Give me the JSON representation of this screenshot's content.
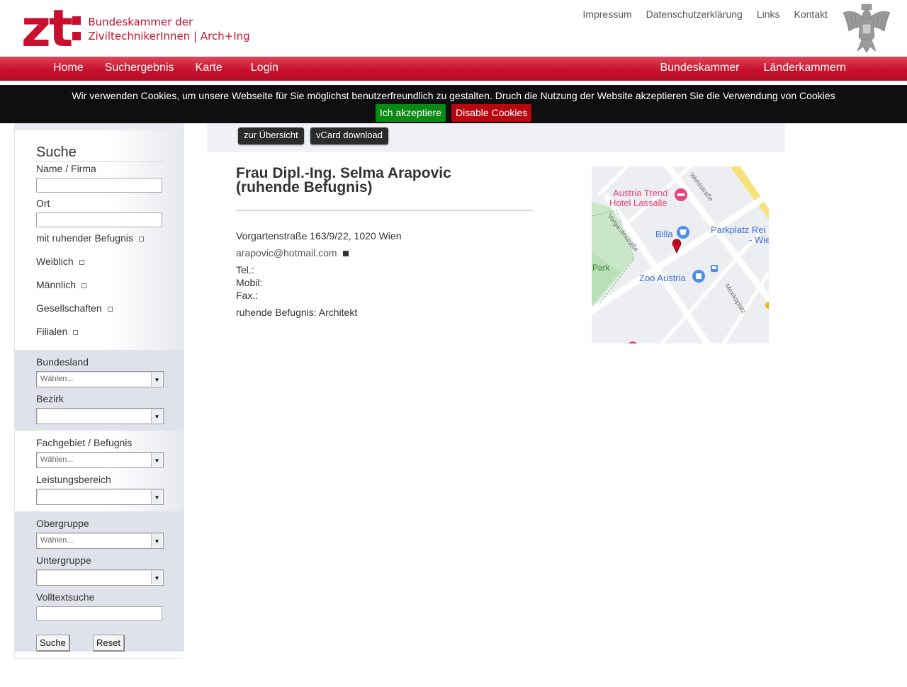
{
  "header": {
    "logo_mark": "zt",
    "logo_line1": "Bundeskammer der",
    "logo_line2": "ZiviltechnikerInnen | Arch+Ing",
    "top_links": [
      "Impressum",
      "Datenschutzerklärung",
      "Links",
      "Kontakt"
    ]
  },
  "nav": {
    "left": [
      "Home",
      "Suchergebnis",
      "Karte",
      "Login"
    ],
    "right": [
      "Bundeskammer",
      "Länderkammern"
    ]
  },
  "cookie": {
    "text": "Wir verwenden Cookies, um unsere Webseite für Sie möglichst benutzerfreundlich zu gestalten. Druch die Nutzung der Website akzeptieren Sie die Verwendung von Cookies",
    "accept_label": "Ich akzeptiere",
    "disable_label": "Disable Cookies"
  },
  "sidebar": {
    "title": "Suche",
    "name_label": "Name / Firma",
    "name_value": "",
    "ort_label": "Ort",
    "ort_value": "",
    "check_ruhend": "mit ruhender Befugnis",
    "check_weiblich": "Weiblich",
    "check_maennlich": "Männlich",
    "check_gesellschaften": "Gesellschaften",
    "check_filialen": "Filialen",
    "bundesland_label": "Bundesland",
    "bundesland_value": "Wählen...",
    "bezirk_label": "Bezirk",
    "bezirk_value": "",
    "fachgebiet_label": "Fachgebiet / Befugnis",
    "fachgebiet_value": "Wählen...",
    "leistung_label": "Leistungsbereich",
    "leistung_value": "",
    "obergruppe_label": "Obergruppe",
    "obergruppe_value": "Wählen...",
    "untergruppe_label": "Untergruppe",
    "untergruppe_value": "",
    "volltext_label": "Volltextsuche",
    "volltext_value": "",
    "search_button": "Suche",
    "reset_button": "Reset"
  },
  "toolbar": {
    "overview_button": "zur Übersicht",
    "vcard_button": "vCard download"
  },
  "person": {
    "name_line1": "Frau Dipl.-Ing. Selma Arapovic",
    "name_line2": "(ruhende Befugnis)",
    "address": "Vorgartenstraße 163/9/22, 1020 Wien",
    "email": "arapovic@hotmail.com",
    "tel_label": "Tel.:",
    "mobil_label": "Mobil:",
    "fax_label": "Fax.:",
    "status": "ruhende Befugnis: Architekt"
  },
  "map": {
    "labels": {
      "hotel_line1": "Austria Trend",
      "hotel_line2": "Hotel Lassalle",
      "billa": "Billa",
      "parkplatz_line1": "Parkplatz Rei",
      "parkplatz_line2": "- Wie",
      "park": "Park",
      "zoo": "Zoo Austria",
      "street_vorgarten": "Vorgartenstraße",
      "street_wehli": "Wehlistraße",
      "street_mexiko": "Mexikoplatz"
    },
    "colors": {
      "poi_pink": "#e8437a",
      "poi_blue": "#4b8ef0",
      "park_green": "#c9e7c7",
      "marker_red": "#d9001b"
    }
  }
}
